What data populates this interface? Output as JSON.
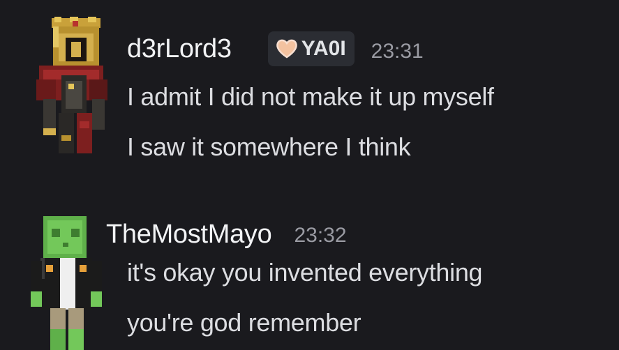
{
  "messages": [
    {
      "username": "d3rLord3",
      "tag": {
        "label": "YA0I",
        "icon": "heart-icon",
        "color": "#f3c2a0"
      },
      "timestamp": "23:31",
      "lines": [
        "I admit I did not make it up myself",
        "I saw it somewhere I think"
      ],
      "avatar": "red-caped-knight-avatar"
    },
    {
      "username": "TheMostMayo",
      "timestamp": "23:32",
      "lines": [
        "it's okay you invented everything",
        "you're god remember"
      ],
      "avatar": "green-slime-avatar"
    }
  ],
  "colors": {
    "background": "#1a1a1e",
    "username": "#f2f3f5",
    "message_text": "#dcdde1",
    "timestamp": "#9a9ba3",
    "tag_background": "#2b2d33"
  }
}
